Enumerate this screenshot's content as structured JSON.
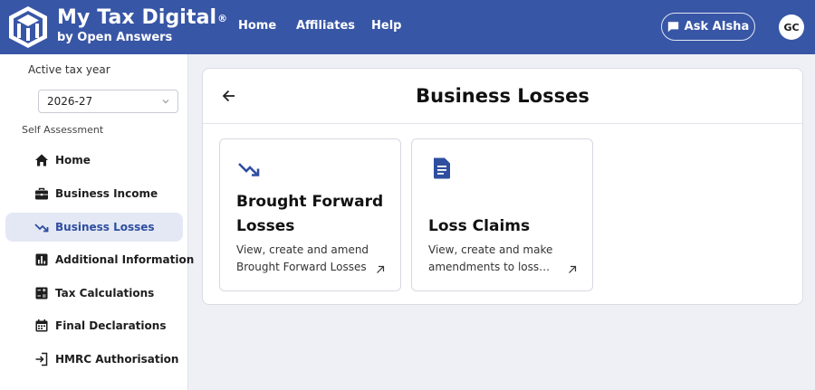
{
  "header": {
    "brand_title": "My Tax Digital",
    "brand_mark": "®",
    "brand_sub": "by Open Answers",
    "nav": [
      "Home",
      "Affiliates",
      "Help"
    ],
    "ask_button": "Ask AIsha",
    "avatar_initials": "GC",
    "bg_color": "#3856a6"
  },
  "sidebar": {
    "tax_year_label": "Active tax year",
    "tax_year_value": "2026-27",
    "section_label": "Self Assessment",
    "items": [
      {
        "label": "Home",
        "icon": "home-icon"
      },
      {
        "label": "Business Income",
        "icon": "briefcase-icon"
      },
      {
        "label": "Business Losses",
        "icon": "trending-down-icon",
        "active": true
      },
      {
        "label": "Additional Information",
        "icon": "bar-chart-icon"
      },
      {
        "label": "Tax Calculations",
        "icon": "calculator-icon"
      },
      {
        "label": "Final Declarations",
        "icon": "calendar-icon"
      },
      {
        "label": "HMRC Authorisation",
        "icon": "login-icon"
      }
    ]
  },
  "main": {
    "title": "Business Losses",
    "cards": [
      {
        "title_lines": [
          "Brought Forward",
          "Losses"
        ],
        "desc_lines": [
          "View, create and amend",
          "Brought Forward Losses"
        ],
        "icon": "trending-down-icon"
      },
      {
        "title_lines": [
          "Loss Claims"
        ],
        "desc_lines": [
          "View, create and make",
          "amendments to loss…"
        ],
        "icon": "document-icon"
      }
    ]
  },
  "colors": {
    "accent": "#3856a6",
    "active_bg": "#e4e8f4",
    "page_bg": "#eef0f6"
  }
}
